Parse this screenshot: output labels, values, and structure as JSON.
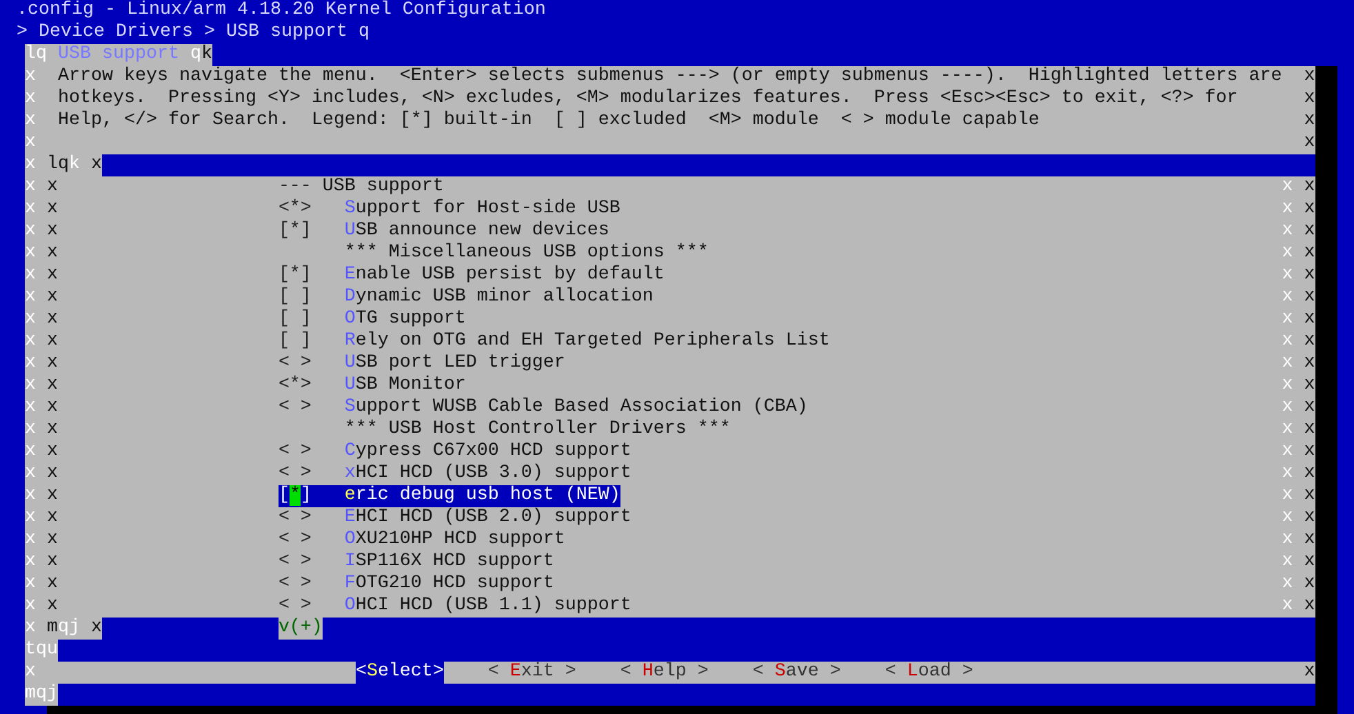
{
  "window": {
    "title": ".config - Linux/arm 4.18.20 Kernel Configuration",
    "breadcrumb": "> Device Drivers > USB support q"
  },
  "dialog": {
    "frame_top": {
      "corner": "lq",
      "title": "USB support",
      "edge": "q",
      "end": "k"
    },
    "help_lines": [
      {
        "left": "x",
        "text": "Arrow keys navigate the menu.  <Enter> selects submenus ---> (or empty submenus ----).  Highlighted letters are",
        "right": "x"
      },
      {
        "left": "x",
        "text": "hotkeys.  Pressing <Y> includes, <N> excludes, <M> modularizes features.  Press <Esc><Esc> to exit, <?> for",
        "right": "x"
      },
      {
        "left": "x",
        "text": "Help, </> for Search.  Legend: [*] built-in  [ ] excluded  <M> module  < > module capable",
        "right": "x"
      },
      {
        "left": "x",
        "right": "x"
      }
    ],
    "menu_top": {
      "left": "x",
      "corner": "lq",
      "corner_end": "k",
      "right": "x"
    },
    "items": [
      {
        "left": [
          "x",
          "x"
        ],
        "kind": "header",
        "status": "---",
        "text": "USB support",
        "right": [
          "x",
          "x"
        ]
      },
      {
        "left": [
          "x",
          "x"
        ],
        "kind": "option",
        "status": "<*>",
        "hotkey": "S",
        "rest": "upport for Host-side USB",
        "selected": false,
        "right": [
          "x",
          "x"
        ]
      },
      {
        "left": [
          "x",
          "x"
        ],
        "kind": "option",
        "status": "[*]",
        "hotkey": "U",
        "rest": "SB announce new devices",
        "selected": false,
        "right": [
          "x",
          "x"
        ]
      },
      {
        "left": [
          "x",
          "x"
        ],
        "kind": "comment",
        "text": "*** Miscellaneous USB options ***",
        "right": [
          "x",
          "x"
        ]
      },
      {
        "left": [
          "x",
          "x"
        ],
        "kind": "option",
        "status": "[*]",
        "hotkey": "E",
        "rest": "nable USB persist by default",
        "selected": false,
        "right": [
          "x",
          "x"
        ]
      },
      {
        "left": [
          "x",
          "x"
        ],
        "kind": "option",
        "status": "[ ]",
        "hotkey": "D",
        "rest": "ynamic USB minor allocation",
        "selected": false,
        "right": [
          "x",
          "x"
        ]
      },
      {
        "left": [
          "x",
          "x"
        ],
        "kind": "option",
        "status": "[ ]",
        "hotkey": "O",
        "rest": "TG support",
        "selected": false,
        "right": [
          "x",
          "x"
        ]
      },
      {
        "left": [
          "x",
          "x"
        ],
        "kind": "option",
        "status": "[ ]",
        "hotkey": "R",
        "rest": "ely on OTG and EH Targeted Peripherals List",
        "selected": false,
        "right": [
          "x",
          "x"
        ]
      },
      {
        "left": [
          "x",
          "x"
        ],
        "kind": "option",
        "status": "< >",
        "hotkey": "U",
        "rest": "SB port LED trigger",
        "selected": false,
        "right": [
          "x",
          "x"
        ]
      },
      {
        "left": [
          "x",
          "x"
        ],
        "kind": "option",
        "status": "<*>",
        "hotkey": "U",
        "rest": "SB Monitor",
        "selected": false,
        "right": [
          "x",
          "x"
        ]
      },
      {
        "left": [
          "x",
          "x"
        ],
        "kind": "option",
        "status": "< >",
        "hotkey": "S",
        "rest": "upport WUSB Cable Based Association (CBA)",
        "selected": false,
        "right": [
          "x",
          "x"
        ]
      },
      {
        "left": [
          "x",
          "x"
        ],
        "kind": "comment",
        "text": "*** USB Host Controller Drivers ***",
        "right": [
          "x",
          "x"
        ]
      },
      {
        "left": [
          "x",
          "x"
        ],
        "kind": "option",
        "status": "< >",
        "hotkey": "C",
        "rest": "ypress C67x00 HCD support",
        "selected": false,
        "right": [
          "x",
          "x"
        ]
      },
      {
        "left": [
          "x",
          "x"
        ],
        "kind": "option",
        "status": "< >",
        "hotkey": "x",
        "rest": "HCI HCD (USB 3.0) support",
        "selected": false,
        "right": [
          "x",
          "x"
        ]
      },
      {
        "left": [
          "x",
          "x"
        ],
        "kind": "option",
        "status": "[*]",
        "hotkey": "e",
        "rest": "ric debug usb host (NEW)",
        "selected": true,
        "right": [
          "x",
          "x"
        ]
      },
      {
        "left": [
          "x",
          "x"
        ],
        "kind": "option",
        "status": "< >",
        "hotkey": "E",
        "rest": "HCI HCD (USB 2.0) support",
        "selected": false,
        "right": [
          "x",
          "x"
        ]
      },
      {
        "left": [
          "x",
          "x"
        ],
        "kind": "option",
        "status": "< >",
        "hotkey": "O",
        "rest": "XU210HP HCD support",
        "selected": false,
        "right": [
          "x",
          "x"
        ]
      },
      {
        "left": [
          "x",
          "x"
        ],
        "kind": "option",
        "status": "< >",
        "hotkey": "I",
        "rest": "SP116X HCD support",
        "selected": false,
        "right": [
          "x",
          "x"
        ]
      },
      {
        "left": [
          "x",
          "x"
        ],
        "kind": "option",
        "status": "< >",
        "hotkey": "F",
        "rest": "OTG210 HCD support",
        "selected": false,
        "right": [
          "x",
          "x"
        ]
      },
      {
        "left": [
          "x",
          "x"
        ],
        "kind": "option",
        "status": "< >",
        "hotkey": "O",
        "rest": "HCI HCD (USB 1.1) support",
        "selected": false,
        "right": [
          "x",
          "x"
        ]
      }
    ],
    "menu_bottom": {
      "left": "x",
      "corner": "m",
      "corner_end": "qj",
      "right": "x",
      "indicator": "v(+)"
    },
    "divider": "tqu",
    "button_row": {
      "left": "x",
      "right": "x",
      "buttons": [
        {
          "open": "<",
          "hotkey": "S",
          "rest": "elect",
          "close": ">",
          "selected": true
        },
        {
          "open": "< ",
          "hotkey": "E",
          "rest": "xit",
          "close": " >",
          "selected": false
        },
        {
          "open": "< ",
          "hotkey": "H",
          "rest": "elp",
          "close": " >",
          "selected": false
        },
        {
          "open": "< ",
          "hotkey": "S",
          "rest": "ave",
          "close": " >",
          "selected": false
        },
        {
          "open": "< ",
          "hotkey": "L",
          "rest": "oad",
          "close": " >",
          "selected": false
        }
      ]
    },
    "frame_bottom": "mqj"
  }
}
